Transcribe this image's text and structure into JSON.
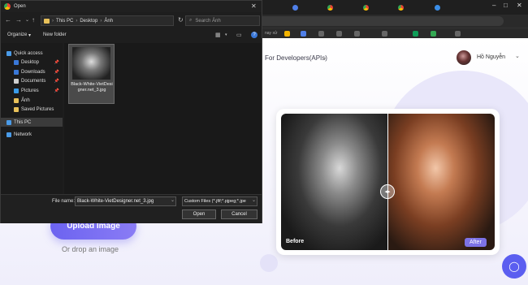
{
  "dialog": {
    "title": "Open",
    "close": "✕",
    "address": [
      "This PC",
      "Desktop",
      "Ảnh"
    ],
    "search_placeholder": "Search Ảnh",
    "toolbar": {
      "organize": "Organize",
      "new_folder": "New folder"
    },
    "nav": [
      {
        "label": "Quick access",
        "color": "#4a9be8"
      },
      {
        "label": "Desktop",
        "color": "#3a78d8",
        "pinned": true
      },
      {
        "label": "Downloads",
        "color": "#3a78d8",
        "pinned": true
      },
      {
        "label": "Documents",
        "color": "#cfcfcf",
        "pinned": true
      },
      {
        "label": "Pictures",
        "color": "#3a9be8",
        "pinned": true
      },
      {
        "label": "Ảnh",
        "color": "#e8c15a"
      },
      {
        "label": "Saved Pictures",
        "color": "#e8c15a"
      },
      {
        "label": "This PC",
        "color": "#4a9be8"
      },
      {
        "label": "Network",
        "color": "#4a9be8"
      }
    ],
    "file": {
      "name": "Black-White-VietDesigner.net_3.jpg"
    },
    "file_name_label": "File name:",
    "file_name_value": "Black-White-VietDesigner.net_3.jpg",
    "file_type": "Custom Files (*.jfif;*.pjpeg;*.jpe",
    "open_button": "Open",
    "cancel_button": "Cancel"
  },
  "site": {
    "dev_link": "For Developers(APIs)",
    "user_name": "Hồ Nguyễn",
    "upload_button": "Upload Image",
    "drop_text": "Or drop an image",
    "before_label": "Before",
    "after_label": "After",
    "bookmark_text": "nay xử"
  },
  "colors": {
    "accent": "#6c63f0",
    "chat": "#5b5ef0"
  }
}
